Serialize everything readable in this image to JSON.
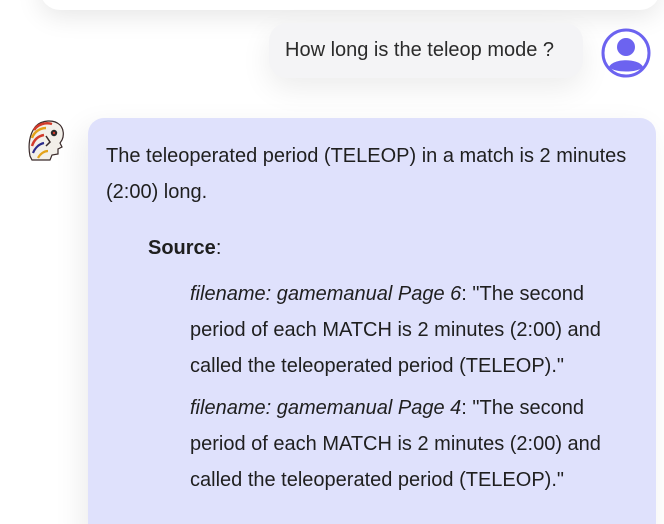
{
  "user_message": {
    "text": "How long is the teleop mode ?"
  },
  "assistant_message": {
    "answer": "The teleoperated period (TELEOP) in a match is 2 minutes (2:00) long.",
    "source_label": "Source",
    "source_colon": ":",
    "sources": [
      {
        "filename": "filename: gamemanual Page 6",
        "quote": ": \"The second period of each MATCH is 2 minutes (2:00) and called the teleoperated period (TELEOP).\""
      },
      {
        "filename": "filename: gamemanual Page 4",
        "quote": ": \"The second period of each MATCH is 2 minutes (2:00) and called the teleoperated period (TELEOP).\""
      }
    ]
  },
  "icons": {
    "user_avatar": "user-circle-icon",
    "bot_avatar": "robot-head-icon"
  },
  "colors": {
    "user_bubble": "#f4f4f6",
    "assistant_bubble": "#dfe1fc",
    "avatar_accent": "#6c63f0"
  }
}
